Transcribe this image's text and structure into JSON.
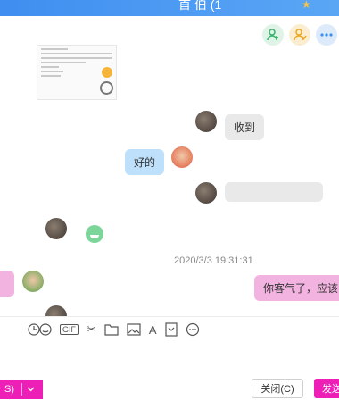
{
  "window": {
    "title": "首 伯 (1",
    "star_icon": "star-icon"
  },
  "top_actions": [
    {
      "name": "add-contact-icon",
      "color": "#37b36a"
    },
    {
      "name": "group-contact-icon",
      "color": "#f0a51e"
    },
    {
      "name": "more-icon",
      "color": "#3d8ef0"
    }
  ],
  "messages": [
    {
      "from": "other",
      "type": "document-thumbnail"
    },
    {
      "from": "self",
      "text": "收到"
    },
    {
      "from": "other",
      "text": "好的"
    },
    {
      "from": "other",
      "type": "emoji"
    },
    {
      "timestamp": "2020/3/3 19:31:31"
    },
    {
      "from": "self",
      "text": "你客气了，应该的"
    }
  ],
  "toolbar": {
    "gif_label": "GIF",
    "font_label": "A",
    "icons": [
      "emoji-icon",
      "gif-icon",
      "scissors-icon",
      "folder-icon",
      "image-icon",
      "font-icon",
      "screenshot-icon",
      "more-circle-icon"
    ]
  },
  "footer": {
    "left_label": "S)",
    "close_label": "关闭(C)",
    "send_label": "发送",
    "accent": "#ee1fb6"
  }
}
